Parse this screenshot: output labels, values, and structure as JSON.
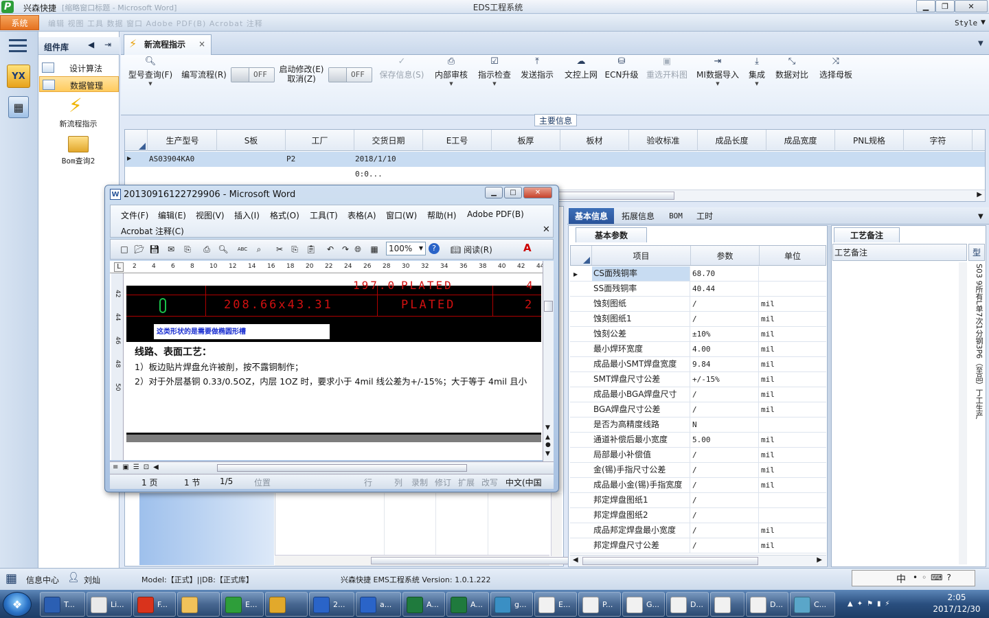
{
  "app": {
    "title_left": "兴森快捷",
    "title_blur": "[缩略窗口标题 - Microsoft Word]",
    "title_center": "EDS工程系统",
    "logo": "P"
  },
  "menu": {
    "system": "系统",
    "blur_items": "编辑  视图  工具  数据  窗口  Adobe PDF(B)   Acrobat 注释",
    "style": "Style"
  },
  "left_strip": {
    "yx": "YX"
  },
  "sidebar": {
    "title": "组件库",
    "items": [
      {
        "label": "设计算法"
      },
      {
        "label": "数据管理"
      }
    ],
    "tools": [
      {
        "label": "新流程指示"
      },
      {
        "label": "Bom查询2"
      }
    ]
  },
  "tabs": [
    {
      "label": "新流程指示",
      "close": "×"
    }
  ],
  "ribbon": {
    "model_query": "型号查询(F)",
    "write_flow": "编写流程(R)",
    "toggle1": "OFF",
    "start_modify": "启动修改(E)",
    "cancel": "取消(Z)",
    "toggle2": "OFF",
    "buttons": [
      {
        "label": "保存信息(S)",
        "disabled": true
      },
      {
        "label": "内部审核"
      },
      {
        "label": "指示检查"
      },
      {
        "label": "发送指示"
      },
      {
        "label": "文控上网"
      },
      {
        "label": "ECN升级"
      },
      {
        "label": "重选开料图",
        "disabled": true
      },
      {
        "label": "MI数据导入"
      },
      {
        "label": "集成"
      },
      {
        "label": "数据对比"
      },
      {
        "label": "选择母板"
      }
    ]
  },
  "main": {
    "section_title": "主要信息",
    "columns": [
      "生产型号",
      "S板",
      "工厂",
      "交货日期",
      "E工号",
      "板厚",
      "板材",
      "验收标准",
      "成品长度",
      "成品宽度",
      "PNL规格",
      "字符"
    ],
    "rows": [
      [
        "AS03904KA0",
        "",
        "P2",
        "2018/1/10 0:0...",
        "",
        "",
        "",
        "",
        "",
        "",
        "",
        ""
      ]
    ]
  },
  "right_tabs": [
    "基本信息",
    "拓展信息",
    "BOM",
    "工时"
  ],
  "params": {
    "title": "基本参数",
    "columns": [
      "项目",
      "参数",
      "单位"
    ],
    "rows": [
      {
        "item": "CS面残铜率",
        "value": "68.70",
        "unit": ""
      },
      {
        "item": "SS面残铜率",
        "value": "40.44",
        "unit": ""
      },
      {
        "item": "蚀刻图纸",
        "value": "/",
        "unit": "mil"
      },
      {
        "item": "蚀刻图纸1",
        "value": "/",
        "unit": "mil"
      },
      {
        "item": "蚀刻公差",
        "value": "±10%",
        "unit": "mil"
      },
      {
        "item": "最小焊环宽度",
        "value": "4.00",
        "unit": "mil"
      },
      {
        "item": "成品最小SMT焊盘宽度",
        "value": "9.84",
        "unit": "mil"
      },
      {
        "item": "SMT焊盘尺寸公差",
        "value": "+/-15%",
        "unit": "mil"
      },
      {
        "item": "成品最小BGA焊盘尺寸",
        "value": "/",
        "unit": "mil"
      },
      {
        "item": "BGA焊盘尺寸公差",
        "value": "/",
        "unit": "mil"
      },
      {
        "item": "是否为高精度线路",
        "value": "N",
        "unit": ""
      },
      {
        "item": "通道补偿后最小宽度",
        "value": "5.00",
        "unit": "mil"
      },
      {
        "item": "局部最小补偿值",
        "value": "/",
        "unit": "mil"
      },
      {
        "item": "金(锡)手指尺寸公差",
        "value": "/",
        "unit": "mil"
      },
      {
        "item": "成品最小金(锡)手指宽度",
        "value": "/",
        "unit": "mil"
      },
      {
        "item": "邦定焊盘图纸1",
        "value": "/",
        "unit": ""
      },
      {
        "item": "邦定焊盘图纸2",
        "value": "/",
        "unit": ""
      },
      {
        "item": "成品邦定焊盘最小宽度",
        "value": "/",
        "unit": "mil"
      },
      {
        "item": "邦定焊盘尺寸公差",
        "value": "/",
        "unit": "mil"
      }
    ]
  },
  "craft": {
    "title": "工艺备注",
    "column": "工艺备注",
    "side_header": "型",
    "vertical_text": "S03 9所有L单7次1分钢3P6（至品）丁工生产"
  },
  "status": {
    "info_center": "信息中心",
    "user": "刘灿",
    "model_db": "Model:【正式】||DB:【正式库】",
    "version": "兴森快捷 EMS工程系统 Version: 1.0.1.222",
    "ime": "中"
  },
  "word": {
    "title": "20130916122729906 - Microsoft Word",
    "menus": [
      "文件(F)",
      "编辑(E)",
      "视图(V)",
      "插入(I)",
      "格式(O)",
      "工具(T)",
      "表格(A)",
      "窗口(W)",
      "帮助(H)",
      "Adobe PDF(B)"
    ],
    "menu2": "Acrobat 注释(C)",
    "zoom": "100%",
    "read": "阅读(R)",
    "ruler": [
      "2",
      "4",
      "6",
      "8",
      "10",
      "12",
      "14",
      "16",
      "18",
      "20",
      "22",
      "24",
      "26",
      "28",
      "30",
      "32",
      "34",
      "36",
      "38",
      "40",
      "42",
      "44"
    ],
    "vruler": [
      "42",
      "44",
      "46",
      "48",
      "50"
    ],
    "drawing_row1": "208.66x43.31",
    "drawing_row1b": "PLATED",
    "drawing_row1c": "2",
    "drawing_top": "197.0",
    "drawing_topb": "PLATED",
    "drawing_topc": "4",
    "note": "这类形状的是需要做椭圆形槽",
    "heading": "线路、表面工艺：",
    "line1": "1）板边贴片焊盘允许被削，按不露铜制作；",
    "line2": "2）对于外层基铜 0.33/0.5OZ，内层 1OZ 时，要求小于 4mil 线公差为+/-15%；大于等于 4mil 且小",
    "status": {
      "page": "1 页",
      "section": "1 节",
      "pages": "1/5",
      "pos": "位置",
      "line": "行",
      "col": "列",
      "rec": "录制",
      "rev": "修订",
      "ext": "扩展",
      "ovr": "改写",
      "lang": "中文(中国"
    }
  },
  "taskbar": {
    "buttons": [
      {
        "label": "T..."
      },
      {
        "label": "Li..."
      },
      {
        "label": "F..."
      },
      {
        "label": ""
      },
      {
        "label": "E..."
      },
      {
        "label": ""
      },
      {
        "label": "2..."
      },
      {
        "label": "a..."
      },
      {
        "label": "A..."
      },
      {
        "label": "A..."
      },
      {
        "label": "g..."
      },
      {
        "label": "E..."
      },
      {
        "label": "P..."
      },
      {
        "label": "G..."
      },
      {
        "label": "D..."
      },
      {
        "label": ""
      },
      {
        "label": "D..."
      },
      {
        "label": "C..."
      }
    ],
    "time": "2:05",
    "date": "2017/12/30"
  },
  "colors": {
    "accent": "#2a549a",
    "system_btn": "#e5711f",
    "selected_row": "#c8dcf2"
  }
}
